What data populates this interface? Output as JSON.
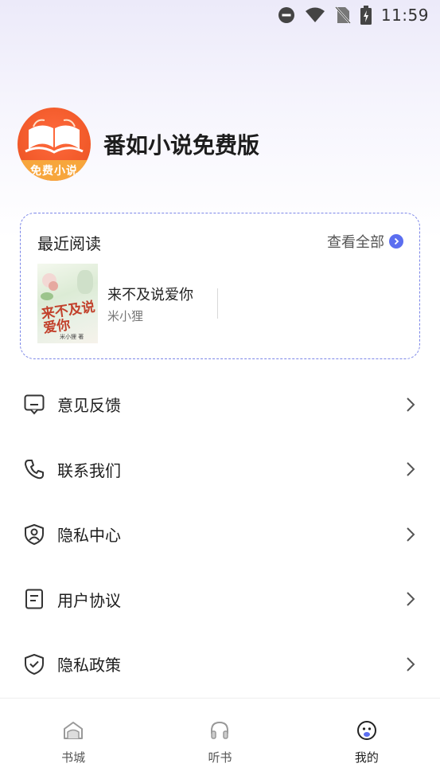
{
  "status_bar": {
    "time": "11:59",
    "icons": [
      "do-not-disturb-icon",
      "wifi-icon",
      "no-sim-icon",
      "battery-charging-icon"
    ]
  },
  "profile": {
    "avatar_text": "免费小说",
    "app_name": "番如小说免费版"
  },
  "recent_reading": {
    "title": "最近阅读",
    "see_all_label": "查看全部",
    "book": {
      "title": "来不及说爱你",
      "author": "米小狸",
      "cover_title": "来不及说爱你",
      "cover_author": "米小狸 著"
    }
  },
  "menu": {
    "items": [
      {
        "label": "意见反馈",
        "icon": "feedback-icon"
      },
      {
        "label": "联系我们",
        "icon": "phone-icon"
      },
      {
        "label": "隐私中心",
        "icon": "privacy-shield-user-icon"
      },
      {
        "label": "用户协议",
        "icon": "document-icon"
      },
      {
        "label": "隐私政策",
        "icon": "shield-check-icon"
      }
    ]
  },
  "bottom_nav": {
    "tabs": [
      {
        "label": "书城",
        "icon": "bookstore-icon",
        "active": false
      },
      {
        "label": "听书",
        "icon": "headphones-icon",
        "active": false
      },
      {
        "label": "我的",
        "icon": "profile-face-icon",
        "active": true
      }
    ]
  },
  "colors": {
    "accent": "#5b6ef0",
    "card_border": "#7c87e8",
    "avatar_orange": "#f25a2a",
    "avatar_band": "#f7a63c"
  }
}
